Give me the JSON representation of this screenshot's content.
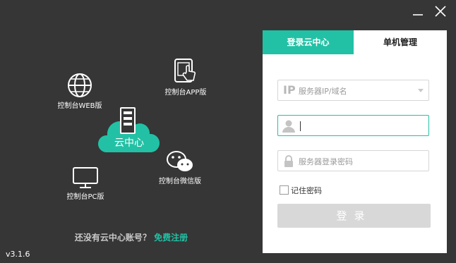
{
  "features": {
    "web_label": "控制台WEB版",
    "app_label": "控制台APP版",
    "pc_label": "控制台PC版",
    "wechat_label": "控制台微信版",
    "cloud_label": "云中心"
  },
  "bottom": {
    "question": "还没有云中心账号？",
    "register": "免费注册"
  },
  "version": "v3.1.6",
  "tabs": {
    "cloud_login": "登录云中心",
    "local_manage": "单机管理"
  },
  "form": {
    "server_tag": "IP",
    "server_placeholder": "服务器IP/域名",
    "username_value": "",
    "password_placeholder": "服务器登录密码",
    "remember_label": "记住密码",
    "login_label": "登录"
  },
  "colors": {
    "accent": "#22c1a5",
    "background": "#363636",
    "login_button": "#d8d8d8"
  }
}
